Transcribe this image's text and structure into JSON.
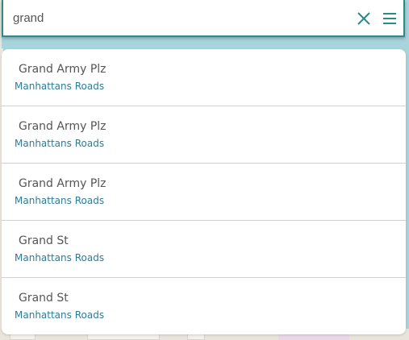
{
  "search": {
    "value": "grand"
  },
  "icons": {
    "clear": "close-icon",
    "menu": "hamburger-menu-icon"
  },
  "colors": {
    "accent": "#2e8a8a",
    "subtitle": "#2a7d99",
    "title": "#555555",
    "map_water": "#a9d6dd"
  },
  "results": [
    {
      "title": "Grand Army Plz",
      "subtitle": "Manhattans Roads"
    },
    {
      "title": "Grand Army Plz",
      "subtitle": "Manhattans Roads"
    },
    {
      "title": "Grand Army Plz",
      "subtitle": "Manhattans Roads"
    },
    {
      "title": "Grand St",
      "subtitle": "Manhattans Roads"
    },
    {
      "title": "Grand St",
      "subtitle": "Manhattans Roads"
    }
  ]
}
